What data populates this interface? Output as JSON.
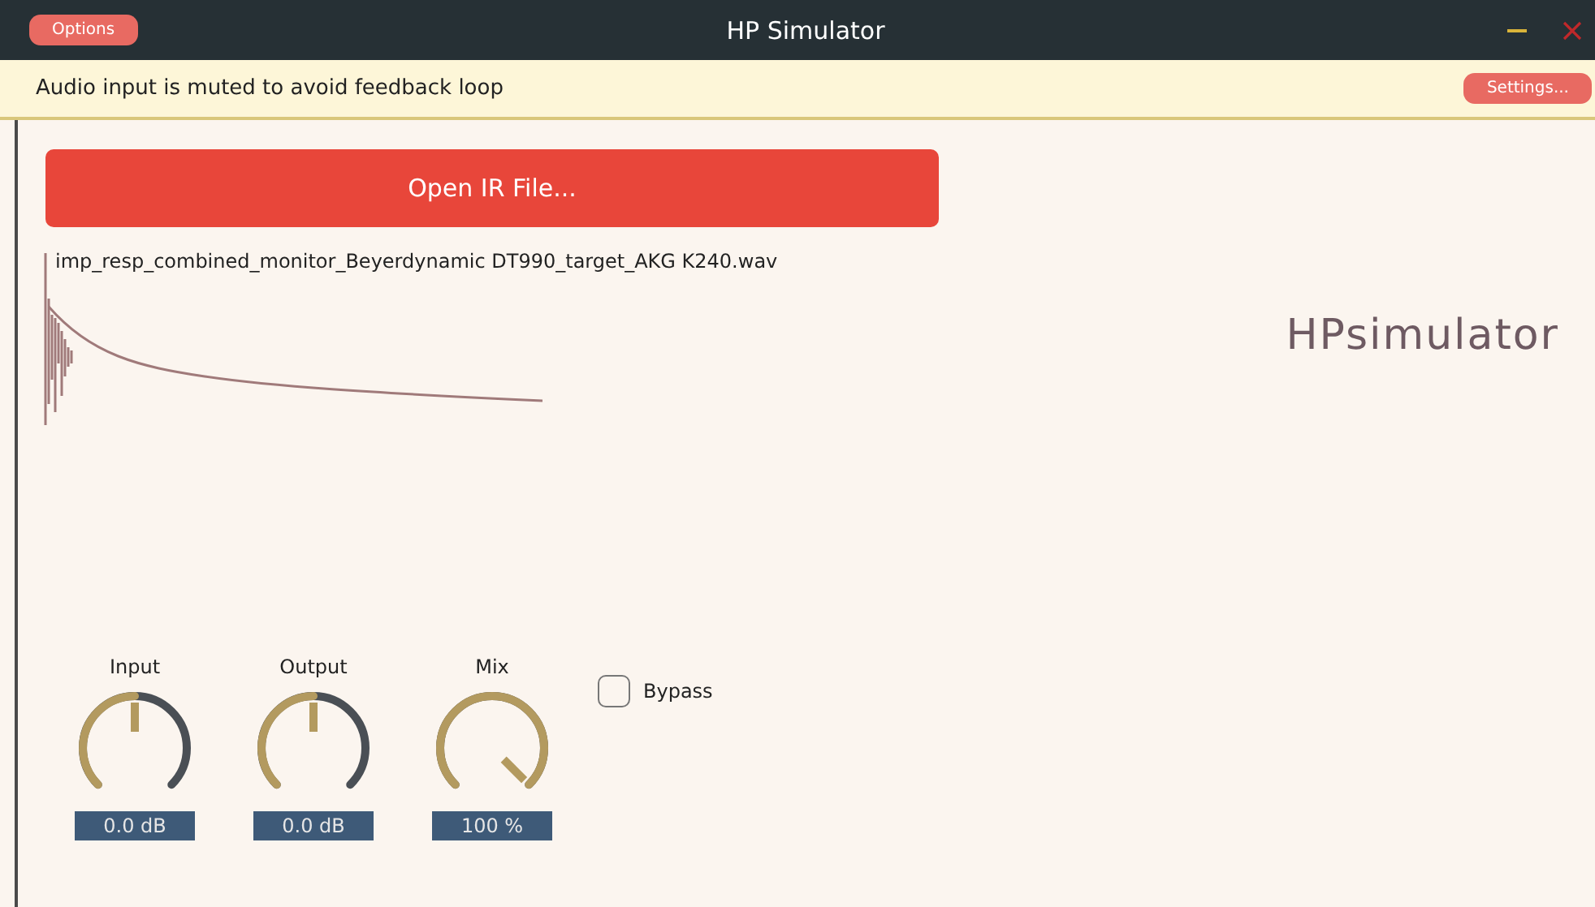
{
  "window": {
    "title": "HP Simulator",
    "options_button": "Options"
  },
  "banner": {
    "message": "Audio input is muted to avoid feedback loop",
    "settings_button": "Settings..."
  },
  "open_button": "Open IR File...",
  "file_name": "imp_resp_combined_monitor_Beyerdynamic DT990_target_AKG K240.wav",
  "logo": "HPsimulator",
  "knobs": [
    {
      "label": "Input",
      "level": 0.5,
      "reading": "0.0 dB"
    },
    {
      "label": "Output",
      "level": 0.5,
      "reading": "0.0 dB"
    },
    {
      "label": "Mix",
      "level": 1,
      "reading": "100 %"
    }
  ],
  "bypass": {
    "label": "Bypass",
    "checked": false
  }
}
